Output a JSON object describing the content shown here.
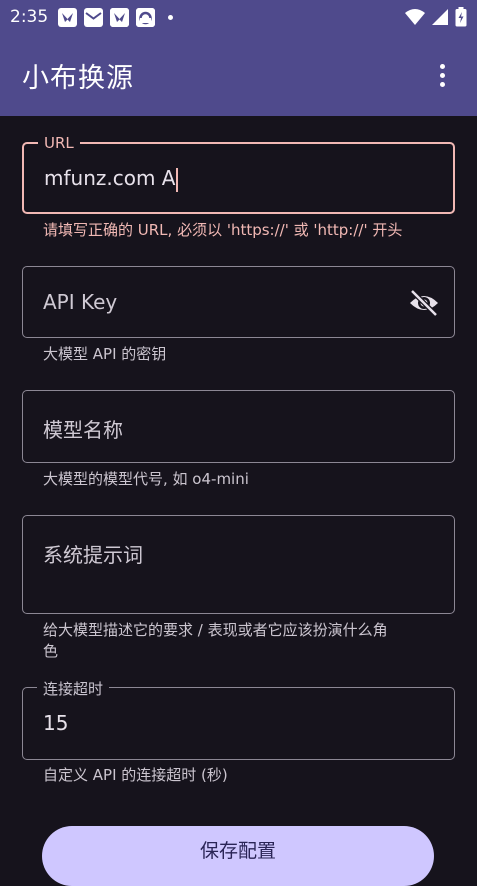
{
  "status_bar": {
    "time": "2:35"
  },
  "app_bar": {
    "title": "小布换源"
  },
  "form": {
    "url": {
      "label": "URL",
      "value": "mfunz.com A",
      "helper": "请填写正确的 URL, 必须以 'https://' 或 'http://' 开头"
    },
    "api_key": {
      "placeholder": "API Key",
      "helper": "大模型 API 的密钥"
    },
    "model_name": {
      "placeholder": "模型名称",
      "helper": "大模型的模型代号, 如 o4-mini"
    },
    "system_prompt": {
      "placeholder": "系统提示词",
      "helper_line1": "给大模型描述它的要求 / 表现或者它应该扮演什么角",
      "helper_line2": "色"
    },
    "timeout": {
      "label": "连接超时",
      "value": "15",
      "helper": "自定义 API 的连接超时 (秒)"
    }
  },
  "save_button": {
    "label": "保存配置"
  },
  "colors": {
    "app_bar": "#4f4a8c",
    "background": "#16131c",
    "error": "#f1b8b4",
    "button": "#cfc7ff"
  }
}
